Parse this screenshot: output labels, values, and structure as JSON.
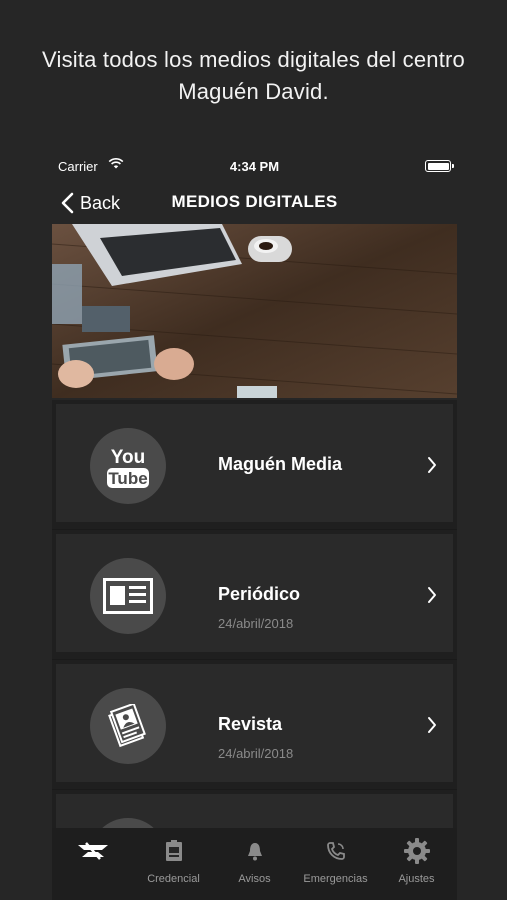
{
  "caption": "Visita todos los medios digitales del centro Maguén David.",
  "status_bar": {
    "carrier": "Carrier",
    "time": "4:34 PM"
  },
  "navbar": {
    "back_label": "Back",
    "title": "MEDIOS DIGITALES"
  },
  "items": [
    {
      "title": "Maguén Media",
      "date": "",
      "icon": "youtube-icon"
    },
    {
      "title": "Periódico",
      "date": "24/abril/2018",
      "icon": "newspaper-icon"
    },
    {
      "title": "Revista",
      "date": "24/abril/2018",
      "icon": "magazine-icon"
    }
  ],
  "youtube_logo": {
    "line1": "You",
    "line2": "Tube"
  },
  "tabs": [
    {
      "label": "",
      "icon": "logo-icon"
    },
    {
      "label": "Credencial",
      "icon": "id-card-icon"
    },
    {
      "label": "Avisos",
      "icon": "bell-icon"
    },
    {
      "label": "Emergencias",
      "icon": "phone-icon"
    },
    {
      "label": "Ajustes",
      "icon": "gear-icon"
    }
  ],
  "colors": {
    "background": "#262626",
    "card": "#2a2a2a",
    "icon_circle": "#4a4a4a",
    "muted_text": "#8a8a8a"
  }
}
